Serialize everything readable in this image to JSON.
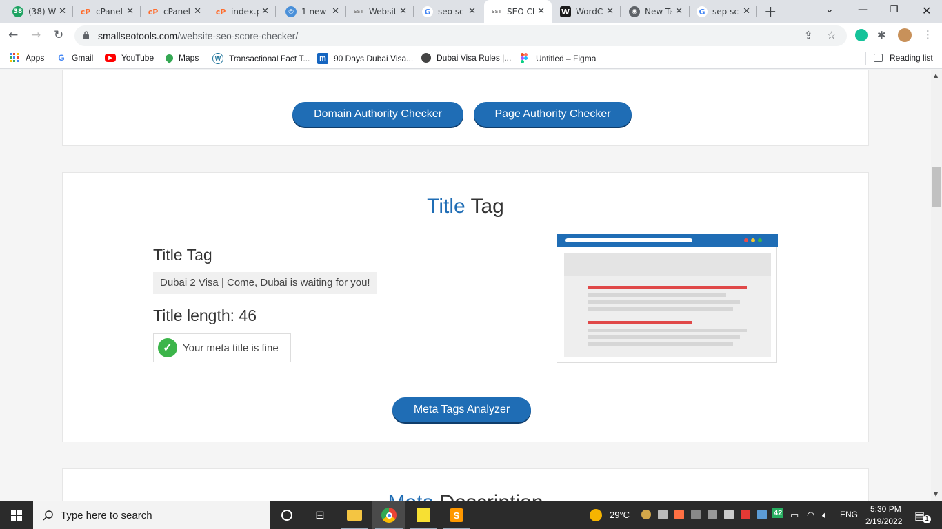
{
  "browser": {
    "tabs": [
      {
        "title": "(38) W",
        "fav_text": "38",
        "fav_color": "#1ea362",
        "x": 0
      },
      {
        "title": "cPanel",
        "fav_text": "cP",
        "fav_color": "#ff6c2c",
        "x": 0
      },
      {
        "title": "cPanel",
        "fav_text": "cP",
        "fav_color": "#ff6c2c",
        "x": 0
      },
      {
        "title": "index.p",
        "fav_text": "cP",
        "fav_color": "#ff6c2c",
        "x": 0
      },
      {
        "title": "1 new",
        "fav_text": "◎",
        "fav_color": "#4a90d9",
        "x": 0
      },
      {
        "title": "Websit",
        "fav_text": "SST",
        "fav_color": "#ffffff",
        "x": 0
      },
      {
        "title": "seo sc",
        "fav_text": "G",
        "fav_color": "#ffffff",
        "x": 0
      },
      {
        "title": "SEO Cl",
        "fav_text": "SST",
        "fav_color": "#ffffff",
        "x": 0,
        "active": true
      },
      {
        "title": "WordC",
        "fav_text": "W",
        "fav_color": "#1b1b1b",
        "x": 0
      },
      {
        "title": "New Ta",
        "fav_text": "◉",
        "fav_color": "#5f6368",
        "x": 0
      },
      {
        "title": "sep sc",
        "fav_text": "G",
        "fav_color": "#ffffff",
        "x": 0
      }
    ],
    "url_host": "smallseotools.com",
    "url_path": "/website-seo-score-checker/",
    "bookmarks": [
      {
        "label": "Apps",
        "icon_color": "#4285f4"
      },
      {
        "label": "Gmail",
        "icon_color": "#ea4335"
      },
      {
        "label": "YouTube",
        "icon_color": "#ff0000"
      },
      {
        "label": "Maps",
        "icon_color": "#34a853"
      },
      {
        "label": "Transactional Fact T...",
        "icon_color": "#21759b"
      },
      {
        "label": "90 Days Dubai Visa...",
        "icon_color": "#1565c0"
      },
      {
        "label": "Dubai Visa Rules |...",
        "icon_color": "#444444"
      },
      {
        "label": "Untitled – Figma",
        "icon_color": "#f24e1e"
      }
    ],
    "reading_list": "Reading list"
  },
  "page": {
    "authority_buttons": {
      "domain": "Domain Authority Checker",
      "page": "Page Authority Checker"
    },
    "title_section": {
      "heading_highlight": "Title",
      "heading_rest": " Tag",
      "subheading": "Title Tag",
      "title_value": "Dubai 2 Visa | Come, Dubai is waiting for you!",
      "length_label": "Title length: 46",
      "status_text": "Your meta title is fine",
      "analyzer_button": "Meta Tags Analyzer"
    },
    "next_section": {
      "heading_highlight": "Meta",
      "heading_rest": " Description"
    }
  },
  "taskbar": {
    "search_placeholder": "Type here to search",
    "weather": "29°C",
    "lang": "ENG",
    "time": "5:30 PM",
    "date": "2/19/2022",
    "notif_count": "1",
    "badge_42": "42"
  }
}
